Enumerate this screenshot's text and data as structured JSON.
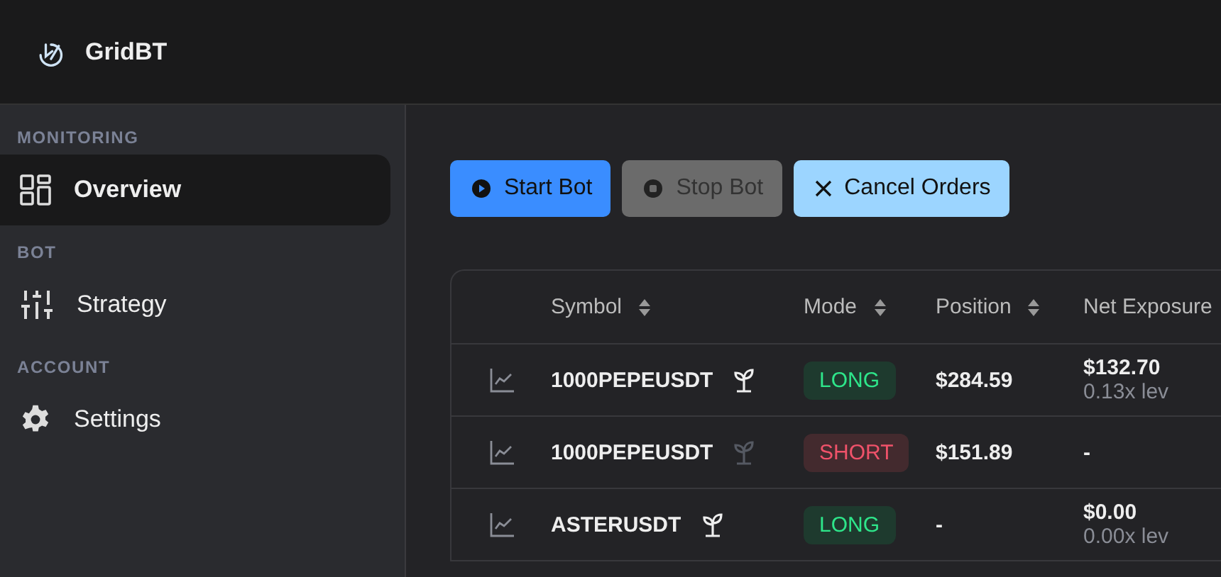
{
  "app": {
    "name": "GridBT"
  },
  "sidebar": {
    "sections": [
      {
        "title": "MONITORING",
        "items": [
          {
            "label": "Overview",
            "kind": "overview",
            "selected": true
          }
        ]
      },
      {
        "title": "BOT",
        "items": [
          {
            "label": "Strategy",
            "kind": "strategy",
            "selected": false
          }
        ]
      },
      {
        "title": "ACCOUNT",
        "items": [
          {
            "label": "Settings",
            "kind": "settings",
            "selected": false
          }
        ]
      }
    ]
  },
  "actions": [
    {
      "label": "Start Bot",
      "kind": "start",
      "disabled": false
    },
    {
      "label": "Stop Bot",
      "kind": "stop",
      "disabled": true
    },
    {
      "label": "Cancel Orders",
      "kind": "cancel",
      "disabled": false
    }
  ],
  "table": {
    "columns": [
      "Symbol",
      "Mode",
      "Position",
      "Net Exposure"
    ],
    "rows": [
      {
        "symbol": "1000PEPEUSDT",
        "active": true,
        "mode": "LONG",
        "kind": "long",
        "position": "$284.59",
        "exposure": "$132.70",
        "leverage": "0.13x lev"
      },
      {
        "symbol": "1000PEPEUSDT",
        "active": false,
        "mode": "SHORT",
        "kind": "short",
        "position": "$151.89",
        "exposure": "-"
      },
      {
        "symbol": "ASTERUSDT",
        "active": true,
        "mode": "LONG",
        "kind": "long",
        "position": "-",
        "exposure": "$0.00",
        "leverage": "0.00x lev"
      }
    ]
  }
}
